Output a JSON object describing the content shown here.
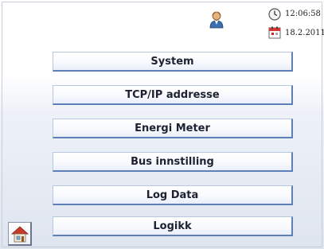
{
  "status": {
    "time": "12:06:58",
    "date": "18.2.2011",
    "icons": [
      "user-icon",
      "clock-icon",
      "calendar-icon"
    ]
  },
  "menu": {
    "items": [
      {
        "label": "System"
      },
      {
        "label": "TCP/IP addresse"
      },
      {
        "label": "Energi Meter"
      },
      {
        "label": "Bus innstilling"
      },
      {
        "label": "Log Data"
      },
      {
        "label": "Logikk"
      }
    ]
  },
  "nav": {
    "home_icon": "home-icon"
  },
  "colors": {
    "button_border": "#5f7fb8",
    "background_bottom": "#dfe5ef"
  }
}
